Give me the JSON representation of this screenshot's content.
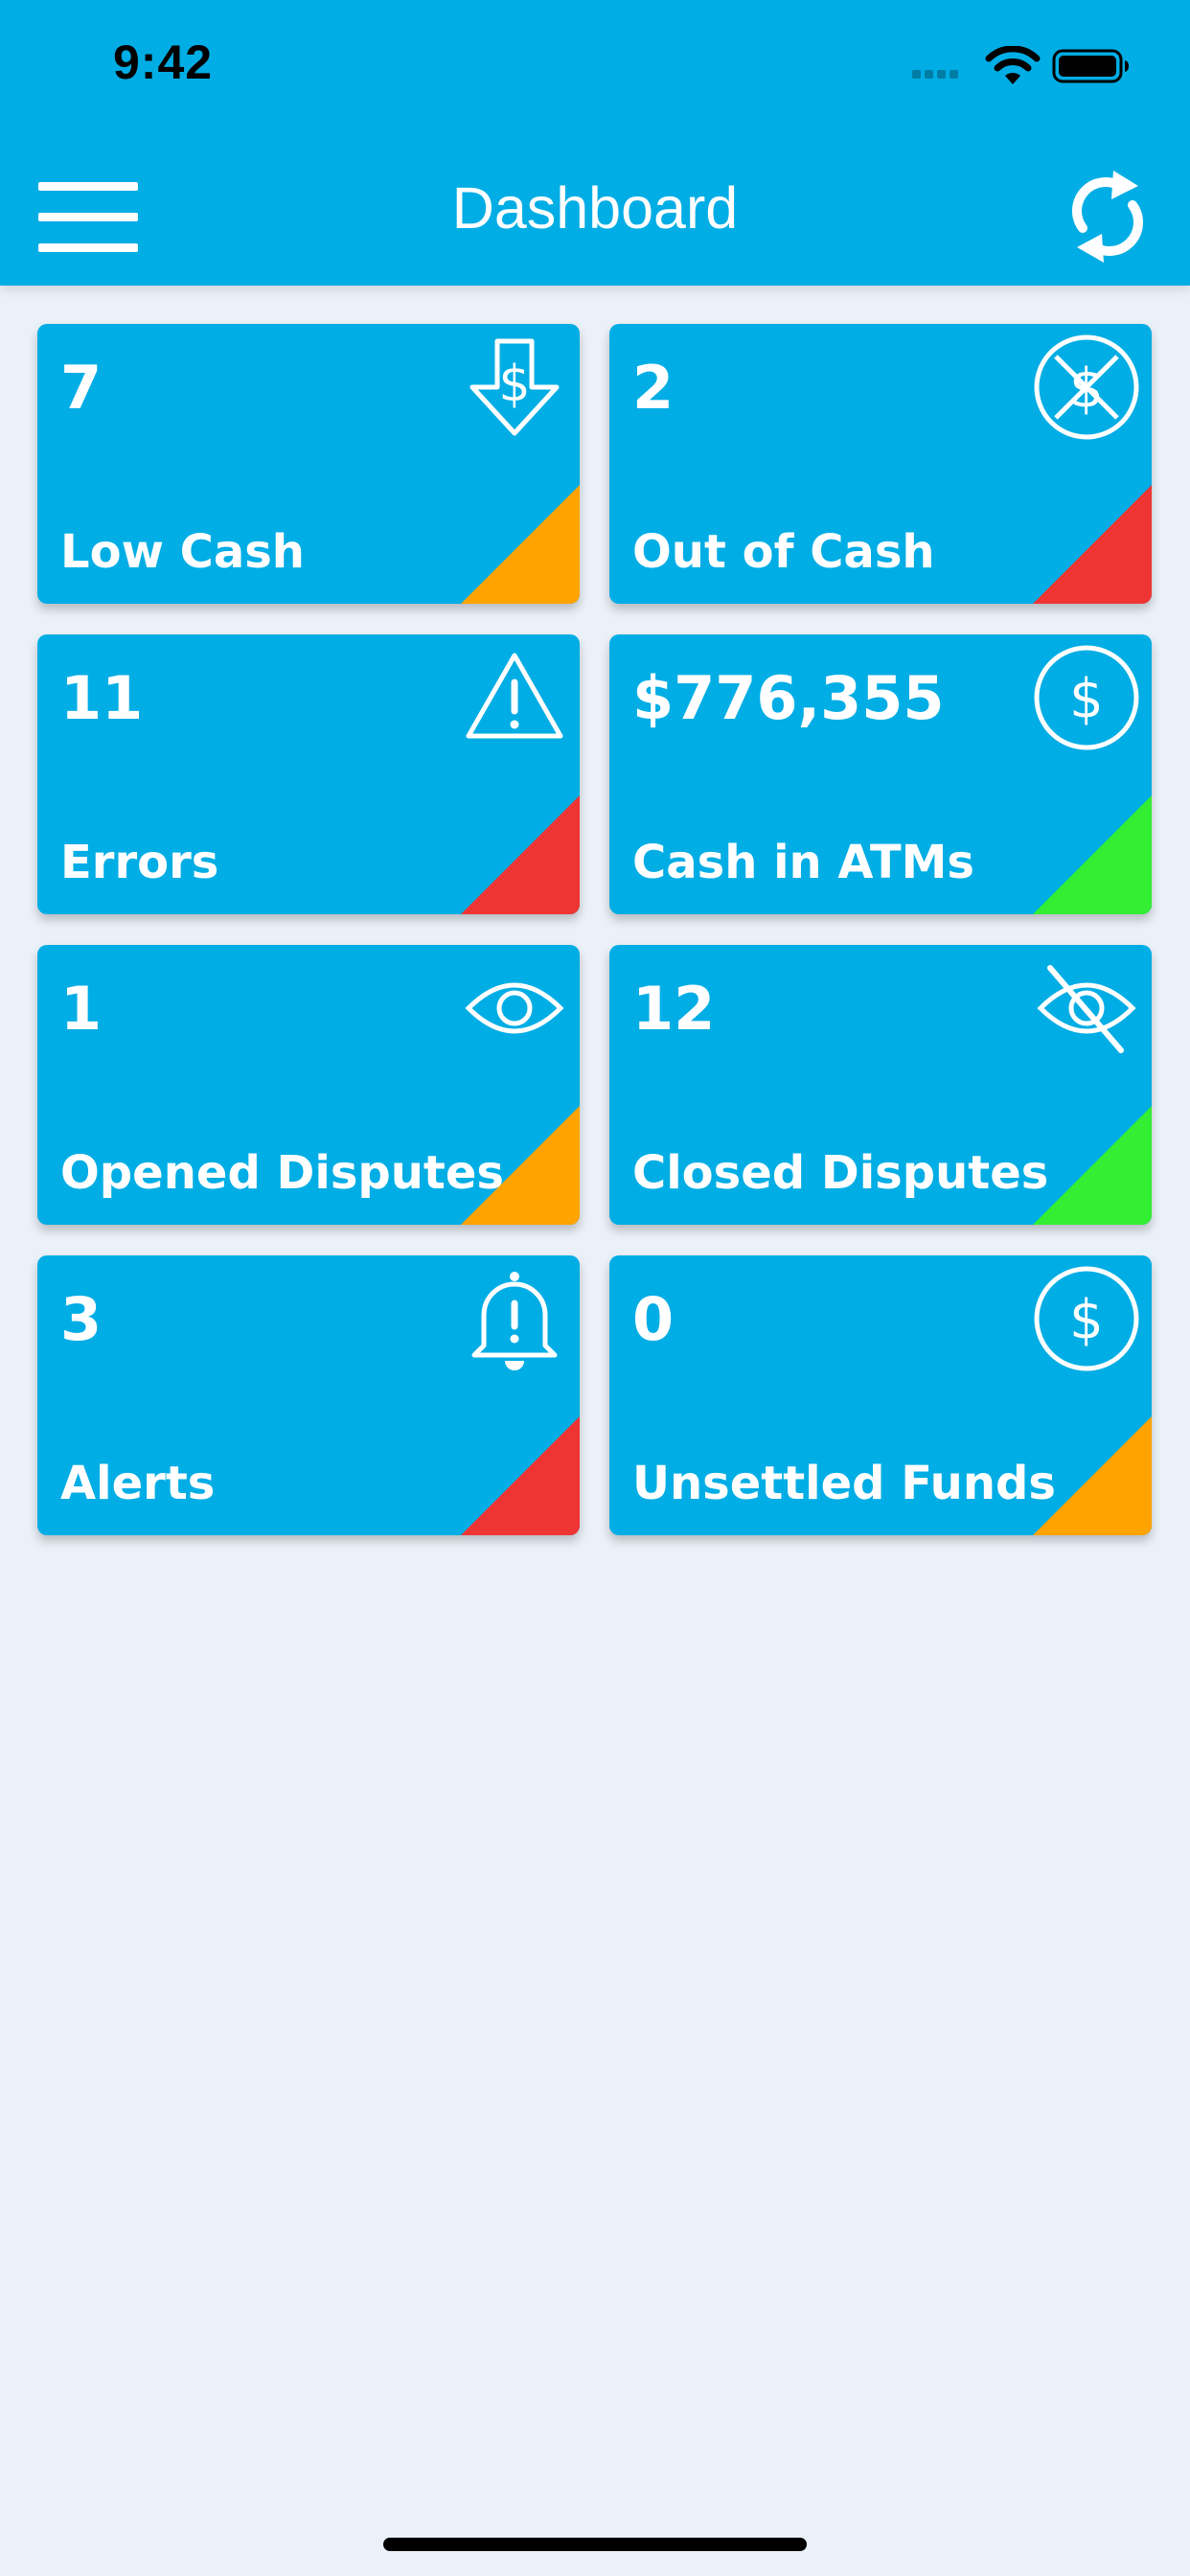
{
  "status_bar": {
    "time": "9:42"
  },
  "nav": {
    "title": "Dashboard",
    "menu_icon": "hamburger-menu-icon",
    "refresh_icon": "refresh-icon"
  },
  "colors": {
    "header": "#00ade5",
    "tile": "#00ade5",
    "background": "#ebf1f8",
    "status_orange": "#ffa300",
    "status_red": "#ef3534",
    "status_green": "#33ee33"
  },
  "tiles": [
    {
      "value": "7",
      "label": "Low Cash",
      "icon": "dollar-down-arrow-icon",
      "status": "orange"
    },
    {
      "value": "2",
      "label": "Out of Cash",
      "icon": "no-dollar-icon",
      "status": "red"
    },
    {
      "value": "11",
      "label": "Errors",
      "icon": "warning-icon",
      "status": "red"
    },
    {
      "value": "$776,355",
      "label": "Cash in ATMs",
      "icon": "dollar-circle-icon",
      "status": "green"
    },
    {
      "value": "1",
      "label": "Opened Disputes",
      "icon": "eye-icon",
      "status": "orange"
    },
    {
      "value": "12",
      "label": "Closed Disputes",
      "icon": "eye-slash-icon",
      "status": "green"
    },
    {
      "value": "3",
      "label": "Alerts",
      "icon": "bell-alert-icon",
      "status": "red"
    },
    {
      "value": "0",
      "label": "Unsettled Funds",
      "icon": "dollar-circle-icon",
      "status": "orange"
    }
  ]
}
